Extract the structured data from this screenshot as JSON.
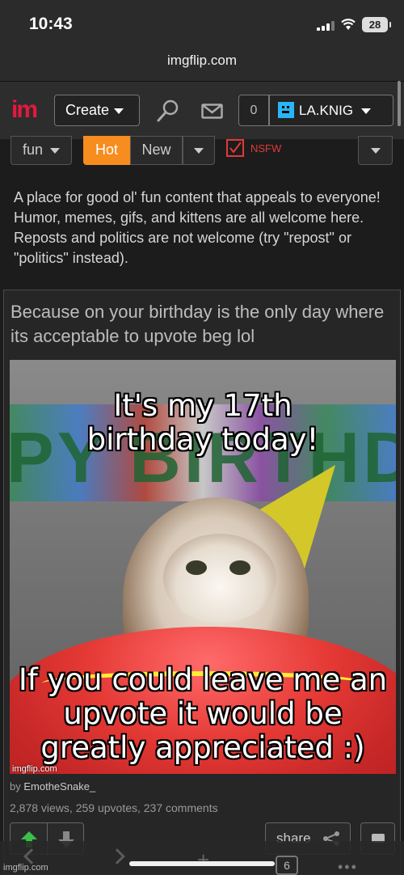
{
  "status": {
    "time": "10:43",
    "battery": "28"
  },
  "browser": {
    "url": "imgflip.com",
    "tab_count": "6"
  },
  "header": {
    "logo": "im",
    "create_label": "Create",
    "notification_count": "0",
    "username": "LA.KNIG"
  },
  "filters": {
    "stream": "fun",
    "hot": "Hot",
    "new": "New",
    "nsfw": "NSFW"
  },
  "description": "A place for good ol' fun content that appeals to everyone! Humor, memes, gifs, and kittens are all welcome here. Reposts and politics are not welcome (try \"repost\" or \"politics\" instead).",
  "post": {
    "title": "Because on your birthday is the only day where its acceptable to upvote beg lol",
    "meme_top_text": "It's my 17th birthday today!",
    "meme_bottom_text": "If you could leave me an upvote it would be greatly appreciated :)",
    "banner_text": "PY BIRTHD",
    "watermark": "imgflip.com",
    "by_prefix": "by",
    "author": "EmotheSnake_",
    "stats": "2,878 views, 259 upvotes, 237 comments",
    "share_label": "share"
  },
  "footer_watermark": "imgflip.com",
  "colors": {
    "accent": "#f78c1f",
    "logo": "#e6173e",
    "upvote": "#3bbf4a",
    "nsfw": "#e03a3a"
  }
}
